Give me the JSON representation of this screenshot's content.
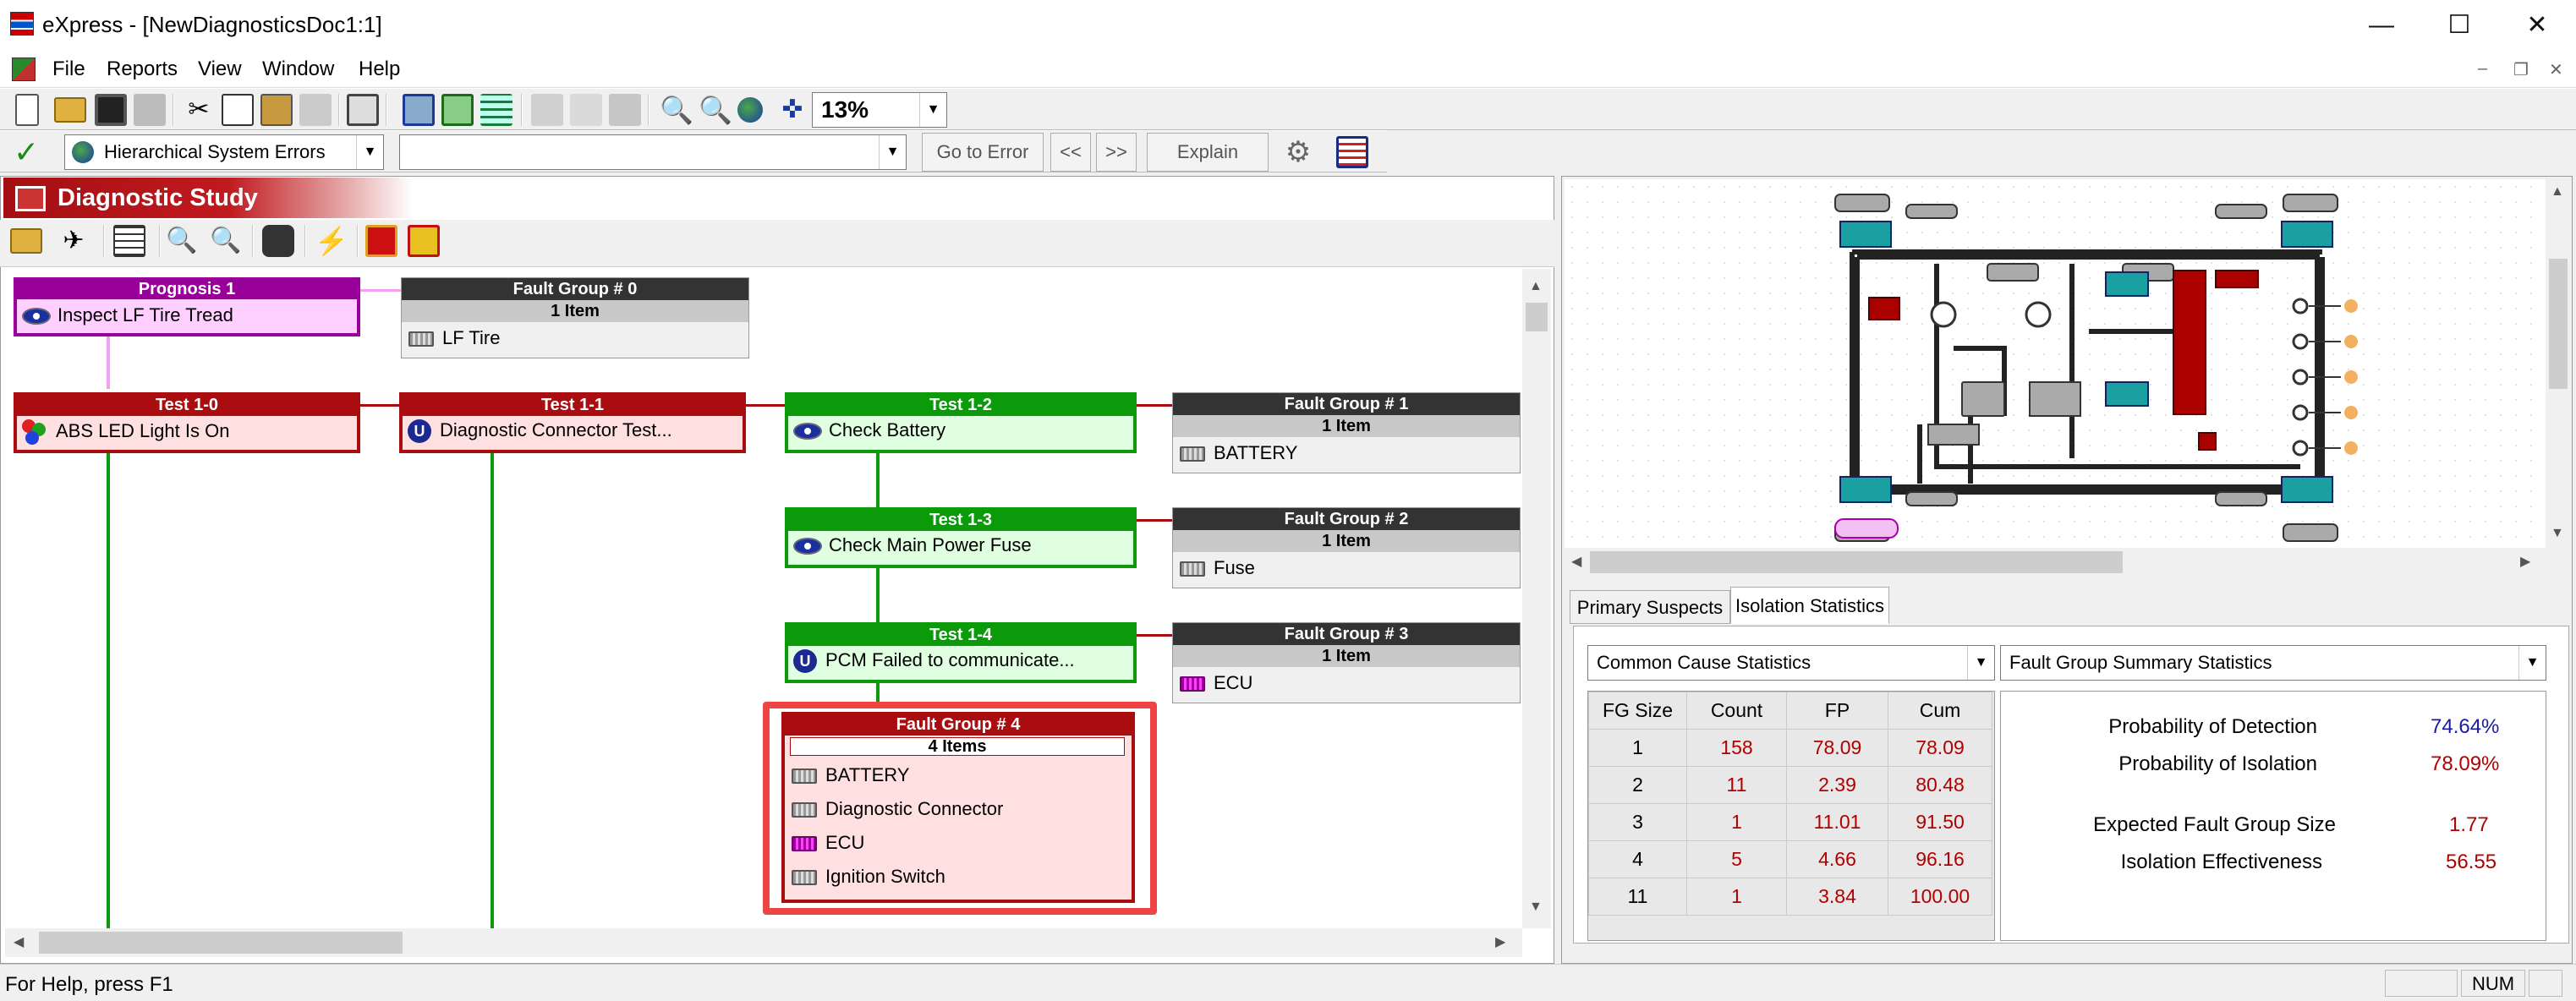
{
  "window": {
    "title": "eXpress - [NewDiagnosticsDoc1:1]",
    "minimize": "—",
    "maximize": "☐",
    "close": "✕"
  },
  "menu": [
    "File",
    "Reports",
    "View",
    "Window",
    "Help"
  ],
  "toolbar": {
    "zoom": "13%"
  },
  "errorbar": {
    "mode": "Hierarchical System Errors",
    "go_to_error": "Go to Error",
    "prev": "<<",
    "next": ">>",
    "explain": "Explain"
  },
  "study": {
    "title": "Diagnostic Study"
  },
  "nodes": {
    "prognosis": {
      "title": "Prognosis 1",
      "text": "Inspect LF Tire Tread"
    },
    "fg0": {
      "title": "Fault Group # 0",
      "count": "1 Item",
      "items": [
        "LF Tire"
      ]
    },
    "t10": {
      "title": "Test 1-0",
      "text": "ABS LED Light Is On"
    },
    "t11": {
      "title": "Test 1-1",
      "text": "Diagnostic Connector Test..."
    },
    "t12": {
      "title": "Test 1-2",
      "text": "Check Battery"
    },
    "fg1": {
      "title": "Fault Group # 1",
      "count": "1 Item",
      "items": [
        "BATTERY"
      ]
    },
    "t13": {
      "title": "Test 1-3",
      "text": "Check Main Power Fuse"
    },
    "fg2": {
      "title": "Fault Group # 2",
      "count": "1 Item",
      "items": [
        "Fuse"
      ]
    },
    "t14": {
      "title": "Test 1-4",
      "text": "PCM Failed to communicate..."
    },
    "fg3": {
      "title": "Fault Group # 3",
      "count": "1 Item",
      "items": [
        "ECU"
      ]
    },
    "fg4": {
      "title": "Fault Group # 4",
      "count": "4 Items",
      "items": [
        "BATTERY",
        "Diagnostic Connector",
        "ECU",
        "Ignition Switch"
      ]
    }
  },
  "tabs": [
    "Primary Suspects",
    "Isolation Statistics"
  ],
  "stats": {
    "left_combo": "Common Cause Statistics",
    "right_combo": "Fault Group Summary Statistics",
    "headers": [
      "FG Size",
      "Count",
      "FP",
      "Cum"
    ],
    "rows": [
      [
        "1",
        "158",
        "78.09",
        "78.09"
      ],
      [
        "2",
        "11",
        "2.39",
        "80.48"
      ],
      [
        "3",
        "1",
        "11.01",
        "91.50"
      ],
      [
        "4",
        "5",
        "4.66",
        "96.16"
      ],
      [
        "11",
        "1",
        "3.84",
        "100.00"
      ]
    ],
    "summary": [
      {
        "label": "Probability of Detection",
        "value": "74.64%"
      },
      {
        "label": "Probability of Isolation",
        "value": "78.09%"
      },
      {
        "label": "Expected Fault Group Size",
        "value": "1.77"
      },
      {
        "label": "Isolation Effectiveness",
        "value": "56.55"
      }
    ]
  },
  "status": {
    "help": "For Help, press F1",
    "num": "NUM"
  },
  "colors": {
    "red": "#aa0d10",
    "green": "#0a9a0a",
    "purple": "#990099",
    "dark": "#333333",
    "value_red": "#b00000",
    "value_blue": "#1a1aa0"
  }
}
